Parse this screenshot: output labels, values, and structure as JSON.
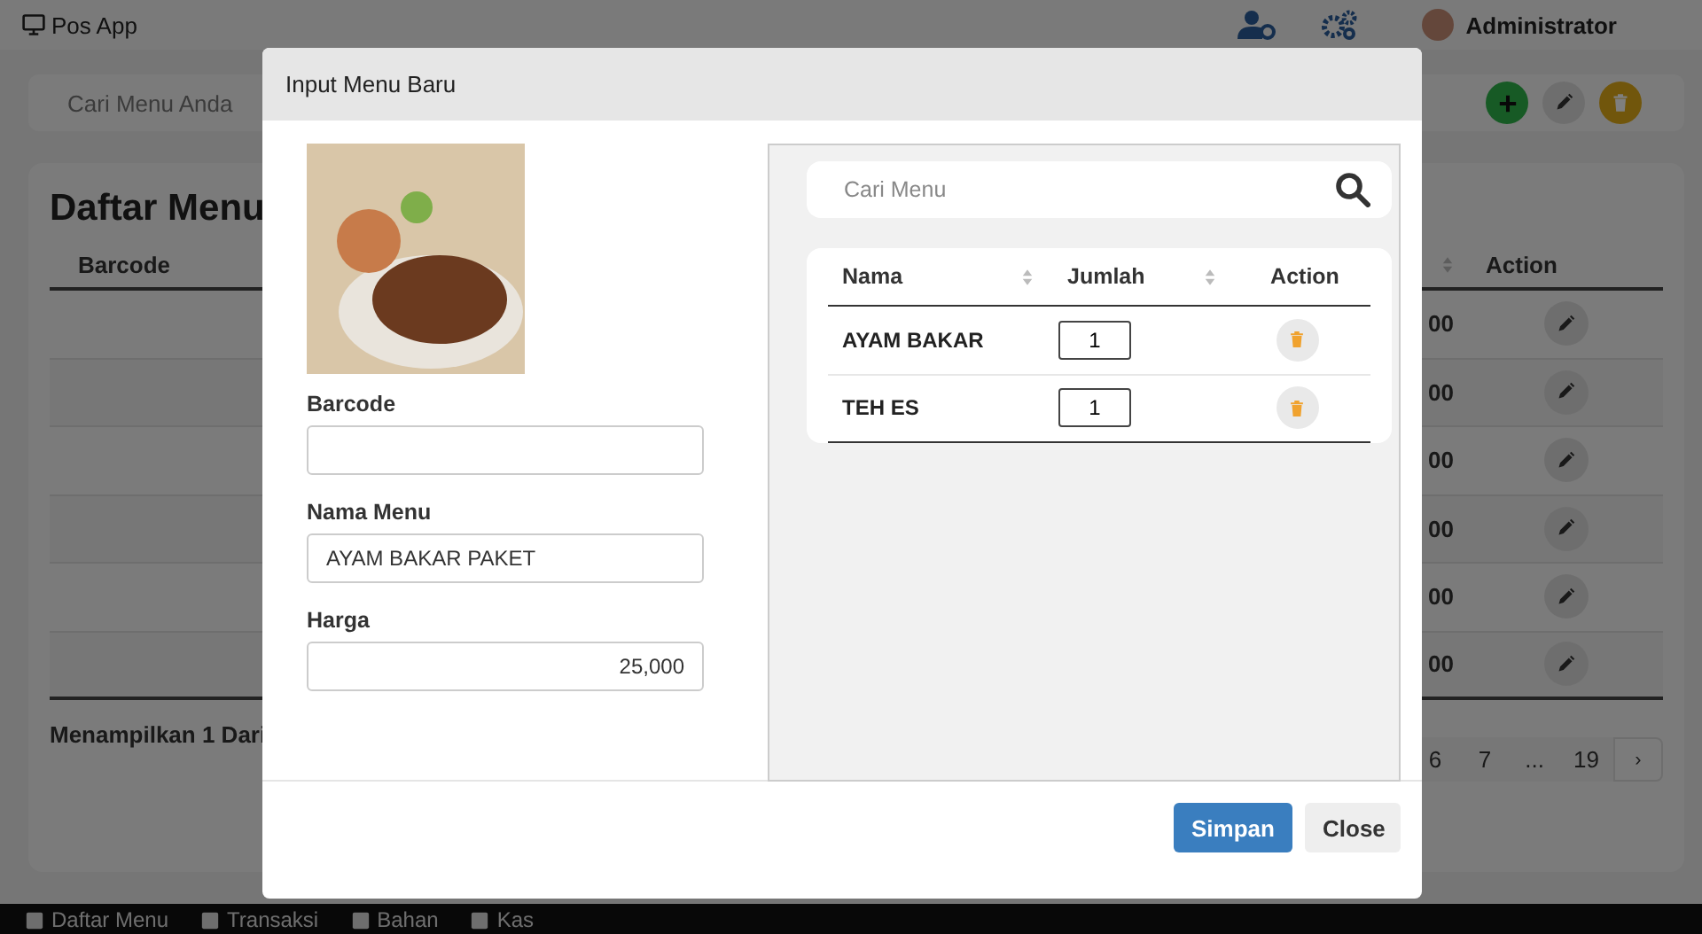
{
  "app": {
    "title": "Pos App",
    "user": "Administrator"
  },
  "search": {
    "placeholder": "Cari Menu Anda"
  },
  "list": {
    "title": "Daftar Menu",
    "columns": [
      {
        "label": "Barcode"
      },
      {
        "sortable": true
      },
      {
        "label": "Action"
      }
    ],
    "rows": [
      {
        "column_2": "00"
      },
      {
        "column_2": "00"
      },
      {
        "column_2": "00"
      },
      {
        "column_2": "00"
      },
      {
        "column_2": "00"
      },
      {
        "column_2": "00"
      }
    ],
    "footer": "Menampilkan 1 Dari",
    "pages": [
      {
        "label": "6",
        "kind": "page"
      },
      {
        "label": "7",
        "kind": "page"
      },
      {
        "label": "...",
        "kind": "page"
      },
      {
        "label": "19",
        "kind": "page"
      },
      {
        "label": "›",
        "kind": "next"
      }
    ]
  },
  "modal": {
    "title": "Input Menu Baru",
    "fields": [
      {
        "label": "Barcode",
        "kind": "text"
      },
      {
        "label": "Nama Menu",
        "value": "AYAM BAKAR PAKET",
        "kind": "text"
      },
      {
        "label": "Harga",
        "value": "25,000",
        "kind": "number"
      }
    ],
    "search": {
      "placeholder": "Cari Menu"
    },
    "columns": [
      {
        "label": "Nama",
        "sortable": true
      },
      {
        "label": "Jumlah",
        "sortable": true
      },
      {
        "label": "Action"
      }
    ],
    "items": [
      {
        "name": "AYAM BAKAR",
        "qty": "1"
      },
      {
        "name": "TEH ES",
        "qty": "1"
      }
    ],
    "buttons": [
      {
        "label": "Simpan",
        "kind": "primary"
      },
      {
        "label": "Close",
        "kind": "secondary"
      }
    ]
  },
  "taskbar": [
    "Daftar Menu",
    "Transaksi",
    "Bahan",
    "Kas"
  ]
}
